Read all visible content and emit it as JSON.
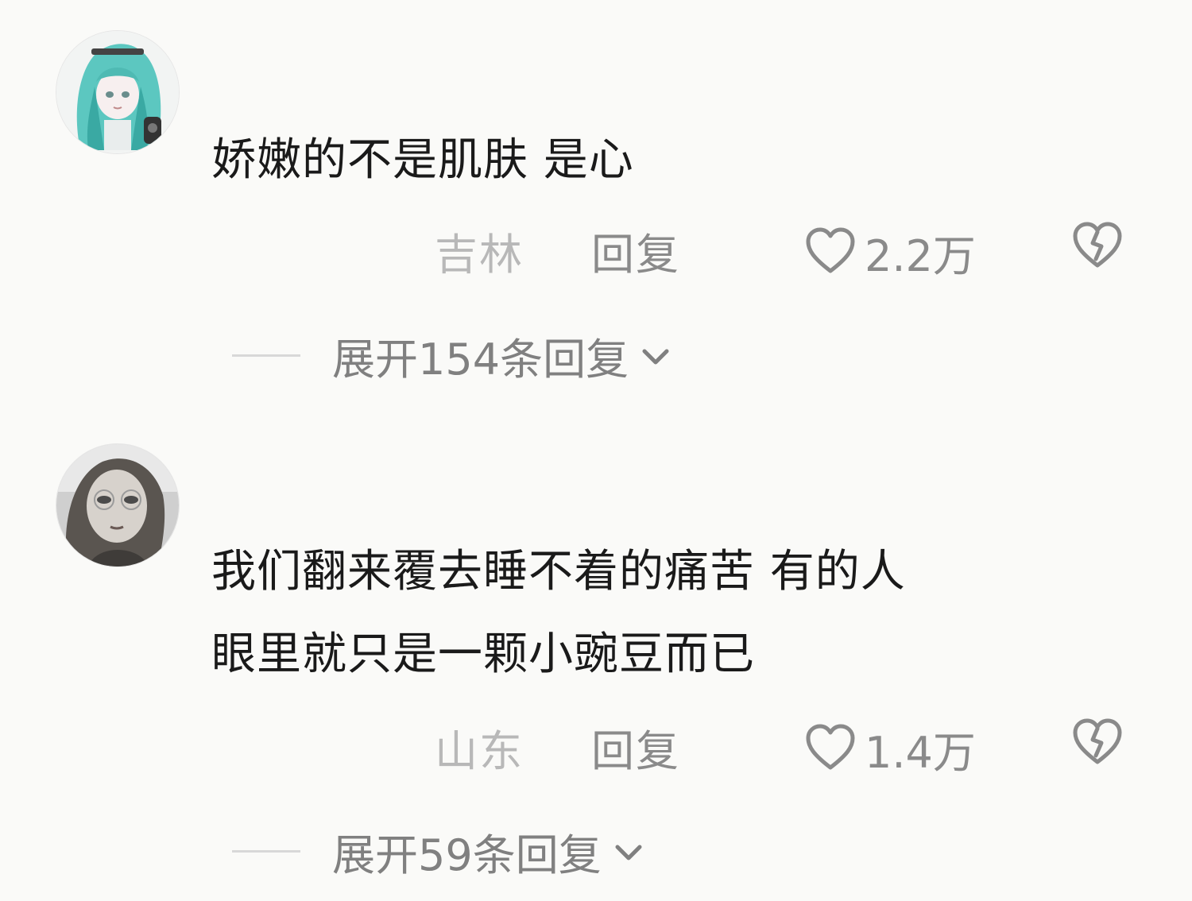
{
  "comments": [
    {
      "text_lines": [
        "娇嫩的不是肌肤 是心"
      ],
      "location": "吉林",
      "reply_label": "回复",
      "like_count": "2.2万",
      "expand_label": "展开154条回复"
    },
    {
      "text_lines": [
        "我们翻来覆去睡不着的痛苦 有的人",
        "眼里就只是一颗小豌豆而已"
      ],
      "location": "山东",
      "reply_label": "回复",
      "like_count": "1.4万",
      "expand_label": "展开59条回复"
    }
  ],
  "icons": {
    "like": "heart-outline-icon",
    "dislike": "broken-heart-icon",
    "expand": "chevron-down-icon"
  },
  "colors": {
    "background": "#fafaf8",
    "text": "#1a1a1a",
    "meta": "#8a8a8a",
    "location": "#b8b8b8"
  }
}
